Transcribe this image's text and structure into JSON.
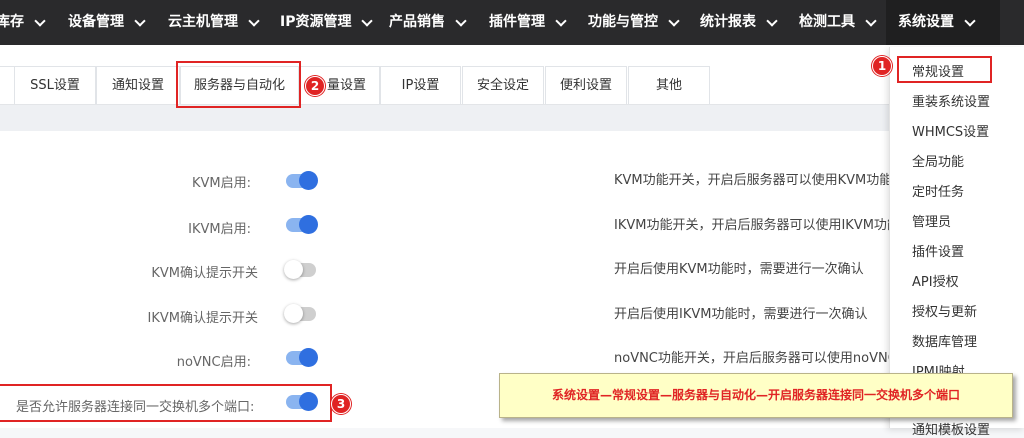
{
  "topnav": {
    "items": [
      {
        "label": "库存"
      },
      {
        "label": "设备管理"
      },
      {
        "label": "云主机管理"
      },
      {
        "label": "IP资源管理"
      },
      {
        "label": "产品销售"
      },
      {
        "label": "插件管理"
      },
      {
        "label": "功能与管控"
      },
      {
        "label": "统计报表"
      },
      {
        "label": "检测工具"
      },
      {
        "label": "系统设置"
      }
    ]
  },
  "tabs": [
    {
      "label": "SSL设置"
    },
    {
      "label": "通知设置"
    },
    {
      "label": "服务器与自动化"
    },
    {
      "label": "量设置"
    },
    {
      "label": "IP设置"
    },
    {
      "label": "安全设定"
    },
    {
      "label": "便利设置"
    },
    {
      "label": "其他"
    }
  ],
  "settings": [
    {
      "label": "KVM启用:",
      "state": "on",
      "desc": "KVM功能开关，开启后服务器可以使用KVM功能"
    },
    {
      "label": "IKVM启用:",
      "state": "on",
      "desc": "IKVM功能开关，开启后服务器可以使用IKVM功能"
    },
    {
      "label": "KVM确认提示开关",
      "state": "off",
      "desc": "开启后使用KVM功能时，需要进行一次确认"
    },
    {
      "label": "IKVM确认提示开关",
      "state": "off",
      "desc": "开启后使用IKVM功能时，需要进行一次确认"
    },
    {
      "label": "noVNC启用:",
      "state": "on",
      "desc": "noVNC功能开关，开启后服务器可以使用noVNC功能"
    },
    {
      "label": "是否允许服务器连接同一交换机多个端口:",
      "state": "on",
      "desc": ""
    }
  ],
  "dropdown": {
    "items": [
      {
        "label": "常规设置"
      },
      {
        "label": "重装系统设置"
      },
      {
        "label": "WHMCS设置"
      },
      {
        "label": "全局功能"
      },
      {
        "label": "定时任务"
      },
      {
        "label": "管理员"
      },
      {
        "label": "插件设置"
      },
      {
        "label": "API授权"
      },
      {
        "label": "授权与更新"
      },
      {
        "label": "数据库管理"
      },
      {
        "label": "IPMI映射"
      },
      {
        "label": "通知模板设置"
      }
    ]
  },
  "markers": [
    "1",
    "2",
    "3"
  ],
  "banner": {
    "text": "系统设置—常规设置—服务器与自动化—开启服务器连接同一交换机多个端口"
  },
  "colors": {
    "highlight": "#e02424",
    "toggle_on": "#2f6fe0",
    "nav_bg": "#2a2a2c",
    "banner_bg": "#ffffc6"
  }
}
